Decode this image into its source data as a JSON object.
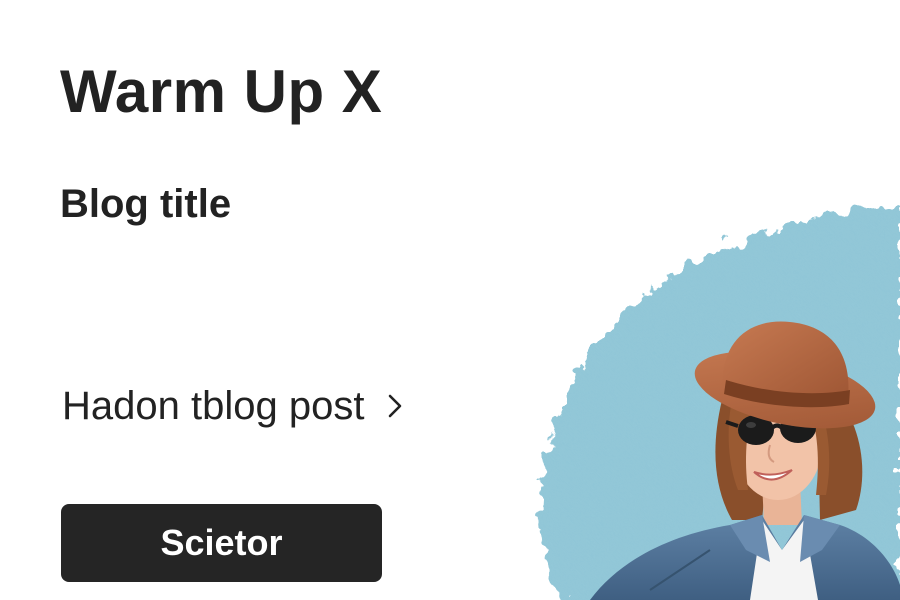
{
  "header": {
    "app_title": "Warm Up X",
    "blog_title": "Blog title"
  },
  "post_link": {
    "label": "Hadon tblog post",
    "icon": "chevron-right-icon"
  },
  "action_button": {
    "label": "Scietor"
  },
  "hero": {
    "icon": "woman-in-hat-illustration",
    "colors": {
      "brush": "#8ec5d6",
      "hat": "#b86b45",
      "jacket": "#4d6f93",
      "hair": "#8a4f2b",
      "skin": "#f2c3a8"
    }
  },
  "colors": {
    "text": "#222222",
    "button_bg": "#252525",
    "button_text": "#ffffff",
    "background": "#ffffff"
  }
}
